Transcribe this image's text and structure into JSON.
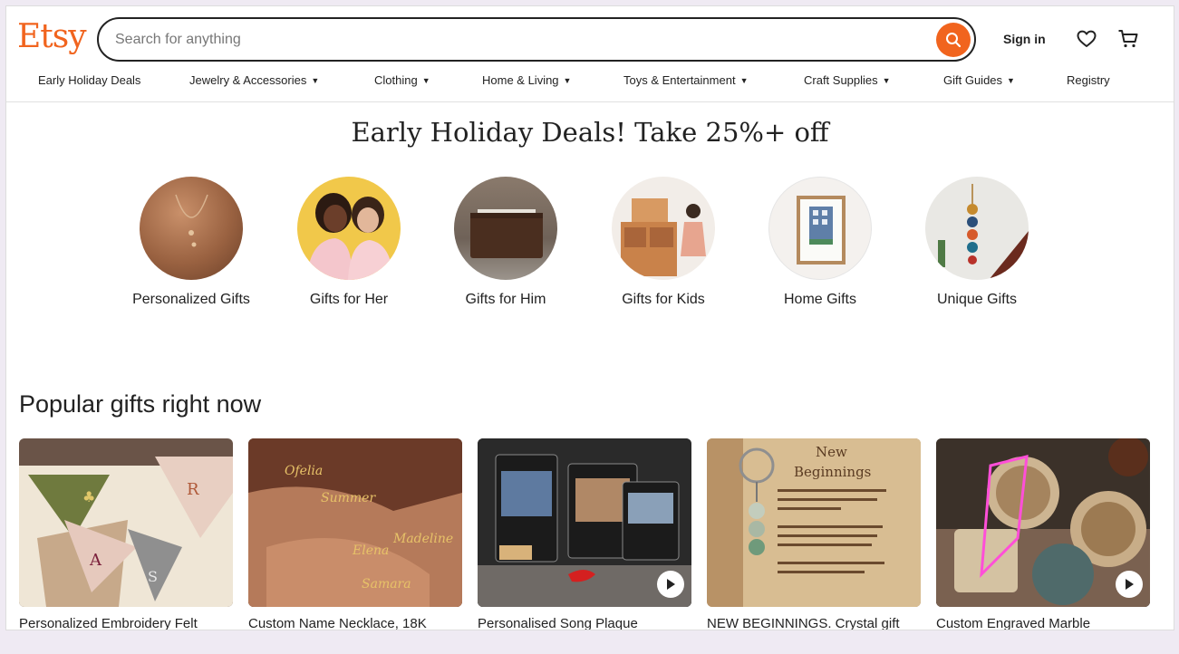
{
  "brand": {
    "logo_text": "Etsy",
    "accent_color": "#F1641E"
  },
  "search": {
    "placeholder": "Search for anything",
    "button_icon": "search-icon"
  },
  "header": {
    "sign_in_label": "Sign in",
    "favorites_icon": "heart-icon",
    "cart_icon": "cart-icon"
  },
  "nav": {
    "items": [
      {
        "label": "Early Holiday Deals",
        "has_dropdown": false
      },
      {
        "label": "Jewelry & Accessories",
        "has_dropdown": true
      },
      {
        "label": "Clothing",
        "has_dropdown": true
      },
      {
        "label": "Home & Living",
        "has_dropdown": true
      },
      {
        "label": "Toys & Entertainment",
        "has_dropdown": true
      },
      {
        "label": "Craft Supplies",
        "has_dropdown": true
      },
      {
        "label": "Gift Guides",
        "has_dropdown": true
      },
      {
        "label": "Registry",
        "has_dropdown": false
      }
    ]
  },
  "hero": {
    "headline": "Early Holiday Deals! Take 25%+ off",
    "categories": [
      {
        "label": "Personalized Gifts"
      },
      {
        "label": "Gifts for Her"
      },
      {
        "label": "Gifts for Him"
      },
      {
        "label": "Gifts for Kids"
      },
      {
        "label": "Home Gifts"
      },
      {
        "label": "Unique Gifts"
      }
    ]
  },
  "popular": {
    "title": "Popular gifts right now",
    "items": [
      {
        "title": "Personalized Embroidery Felt",
        "has_video": false
      },
      {
        "title": "Custom Name Necklace, 18K",
        "has_video": false
      },
      {
        "title": "Personalised Song Plaque",
        "has_video": true
      },
      {
        "title": "NEW BEGINNINGS. Crystal gift",
        "has_video": false
      },
      {
        "title": "Custom Engraved Marble",
        "has_video": true
      }
    ]
  }
}
